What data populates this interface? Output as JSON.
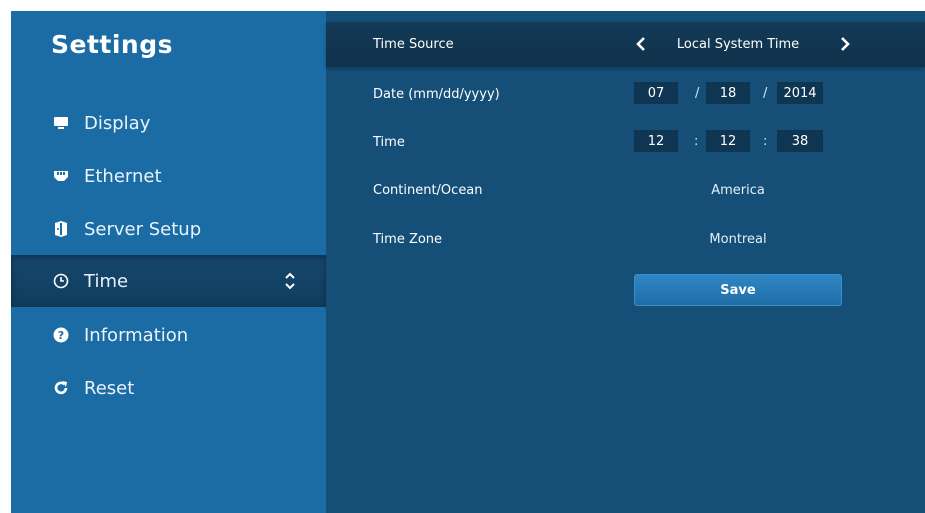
{
  "sidebar": {
    "title": "Settings",
    "items": [
      {
        "label": "Display"
      },
      {
        "label": "Ethernet"
      },
      {
        "label": "Server Setup"
      },
      {
        "label": "Time"
      },
      {
        "label": "Information"
      },
      {
        "label": "Reset"
      }
    ]
  },
  "main": {
    "time_source": {
      "label": "Time Source",
      "value": "Local System Time"
    },
    "date": {
      "label": "Date (mm/dd/yyyy)",
      "month": "07",
      "day": "18",
      "year": "2014",
      "separator": "/"
    },
    "time": {
      "label": "Time",
      "hours": "12",
      "minutes": "12",
      "seconds": "38",
      "separator": ":"
    },
    "continent": {
      "label": "Continent/Ocean",
      "value": "America"
    },
    "timezone": {
      "label": "Time Zone",
      "value": "Montreal"
    },
    "save_label": "Save"
  },
  "colors": {
    "sidebar_bg": "#1b6ca5",
    "main_bg": "#154f78",
    "active_item_bg": "#15476c",
    "field_bg": "#0f3552",
    "accent": "#2f86c4"
  }
}
